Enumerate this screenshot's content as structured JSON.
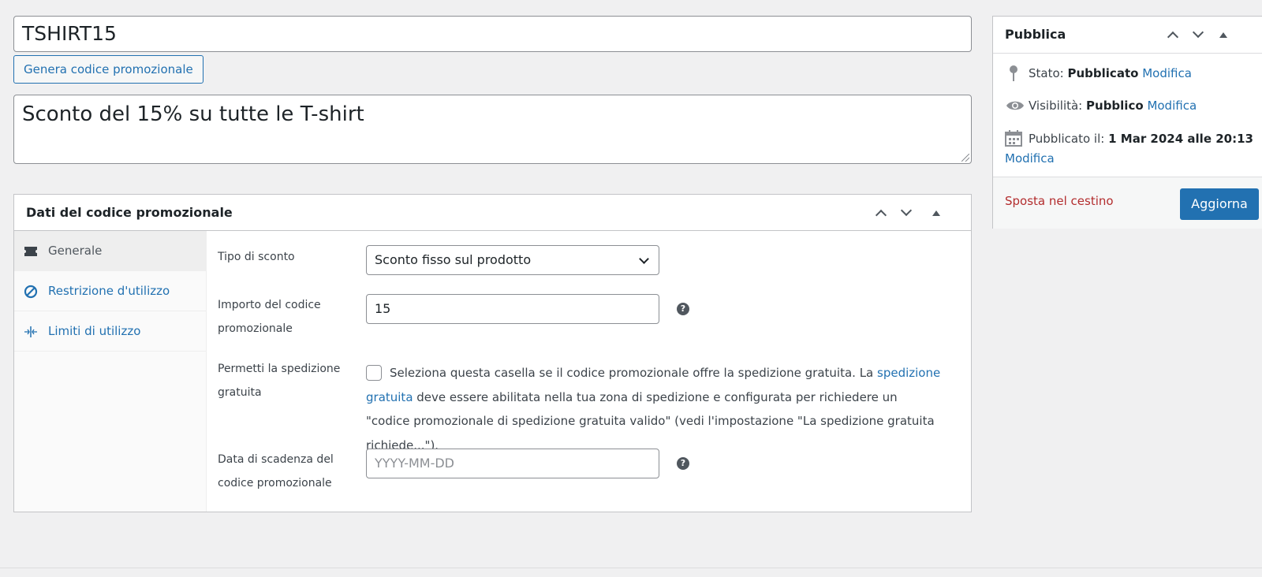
{
  "coupon": {
    "code": "TSHIRT15",
    "generate_button": "Genera codice promozionale",
    "description": "Sconto del 15% su tutte le T-shirt"
  },
  "coupon_data": {
    "title": "Dati del codice promozionale",
    "tabs": [
      {
        "label": "Generale",
        "icon": "ticket-icon",
        "active": true
      },
      {
        "label": "Restrizione d'utilizzo",
        "icon": "restriction-icon",
        "active": false
      },
      {
        "label": "Limiti di utilizzo",
        "icon": "limits-icon",
        "active": false
      }
    ],
    "fields": {
      "discount_type_label": "Tipo di sconto",
      "discount_type_value": "Sconto fisso sul prodotto",
      "amount_label": "Importo del codice promozionale",
      "amount_value": "15",
      "free_shipping_label": "Permetti la spedizione gratuita",
      "free_shipping_text_before": "Seleziona questa casella se il codice promozionale offre la spedizione gratuita. La ",
      "free_shipping_link": "spedizione gratuita",
      "free_shipping_text_after": " deve essere abilitata nella tua zona di spedizione e configurata per richiedere un \"codice promozionale di spedizione gratuita valido\" (vedi l'impostazione \"La spedizione gratuita richiede...\").",
      "expiry_label": "Data di scadenza del codice promozionale",
      "expiry_placeholder": "YYYY-MM-DD"
    },
    "help_glyph": "?"
  },
  "publish": {
    "title": "Pubblica",
    "status_label": "Stato:",
    "status_value": "Pubblicato",
    "visibility_label": "Visibilità:",
    "visibility_value": "Pubblico",
    "published_label": "Pubblicato il:",
    "published_value": "1 Mar 2024 alle 20:13",
    "edit_link": "Modifica",
    "trash_link": "Sposta nel cestino",
    "update_button": "Aggiorna"
  },
  "colors": {
    "accent": "#2271b1",
    "danger": "#b32d2e",
    "background": "#f0f0f1"
  }
}
